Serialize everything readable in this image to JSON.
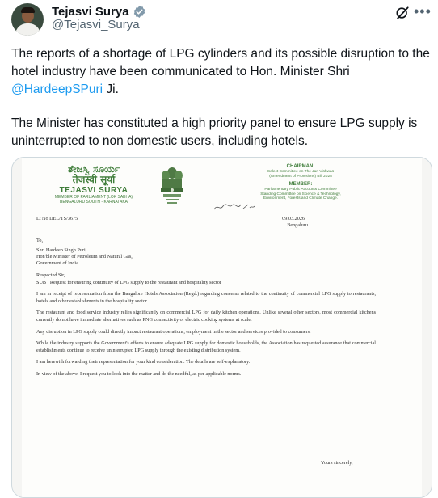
{
  "author": {
    "name": "Tejasvi Surya",
    "handle": "@Tejasvi_Surya"
  },
  "icons": {
    "verified": "verified-badge-icon",
    "grok": "grok-icon",
    "more": "more-options-icon"
  },
  "colors": {
    "link": "#1d9bf0",
    "verified": "#829aab",
    "letterhead": "#3f7d3a"
  },
  "tweet": {
    "line1_before": "The reports of a shortage of LPG cylinders and its possible disruption to the hotel industry have been communicated to Hon. Minister Shri ",
    "mention": "@HardeepSPuri",
    "line1_after": " Ji.",
    "line2": "The Minister has constituted a high priority panel to ensure LPG supply is uninterrupted to non domestic users, including hotels."
  },
  "more_label": "•••",
  "letter": {
    "left_head": {
      "kannada": "ತೇಜಸ್ವಿ ಸೂರ್ಯ",
      "hindi": "तेजस्वी सूर्या",
      "name": "TEJASVI SURYA",
      "sub1": "MEMBER OF PARLIAMENT (LOK SABHA)",
      "sub2": "BENGALURU SOUTH - KARNATAKA"
    },
    "right_head": {
      "chairman": "CHAIRMAN:",
      "chairman_1": "Select Committee on The Jan Vishwas",
      "chairman_2": "(Amendment of Provisions) Bill 2025",
      "member": "MEMBER:",
      "member_1": "Parliamentary Public Accounts Committee",
      "member_2": "Standing Committee on Science & Technology,",
      "member_3": "Environment, Forests and Climate Change."
    },
    "ref": "Lt No DEL/TS/3675",
    "date": "09.03.2026",
    "place": "Bengaluru",
    "to": "To,",
    "addr1": "Shri Hardeep Singh Puri,",
    "addr2": "Hon'ble Minister of Petroleum and Natural Gas,",
    "addr3": "Government of India.",
    "salutation": "Respected Sir,",
    "subject": "SUB : Request for ensuring continuity of LPG supply to the restaurant and hospitality sector",
    "p1": "I am in receipt of representation from the Bangalore Hotels Association (Regd.) regarding concerns related to the continuity of commercial LPG supply to restaurants, hotels and other establishments in the hospitality sector.",
    "p2": "The restaurant and food service industry relies significantly on commercial LPG for daily kitchen operations. Unlike several other sectors, most commercial kitchens currently do not have immediate alternatives such as PNG connectivity or electric cooking systems at scale.",
    "p3": "Any disruption in LPG supply could directly impact restaurant operations, employment in the sector and services provided to consumers.",
    "p4": "While the industry supports the Government's efforts to ensure adequate LPG supply for domestic households, the Association has requested assurance that commercial establishments continue to receive uninterrupted LPG supply through the existing distribution system.",
    "p5": "I am herewith forwarding their representation for your kind consideration. The details are self-explanatory.",
    "p6": "In view of the above, I request you to look into the matter and do the needful, as per applicable norms.",
    "closing": "Yours sincerely,"
  }
}
